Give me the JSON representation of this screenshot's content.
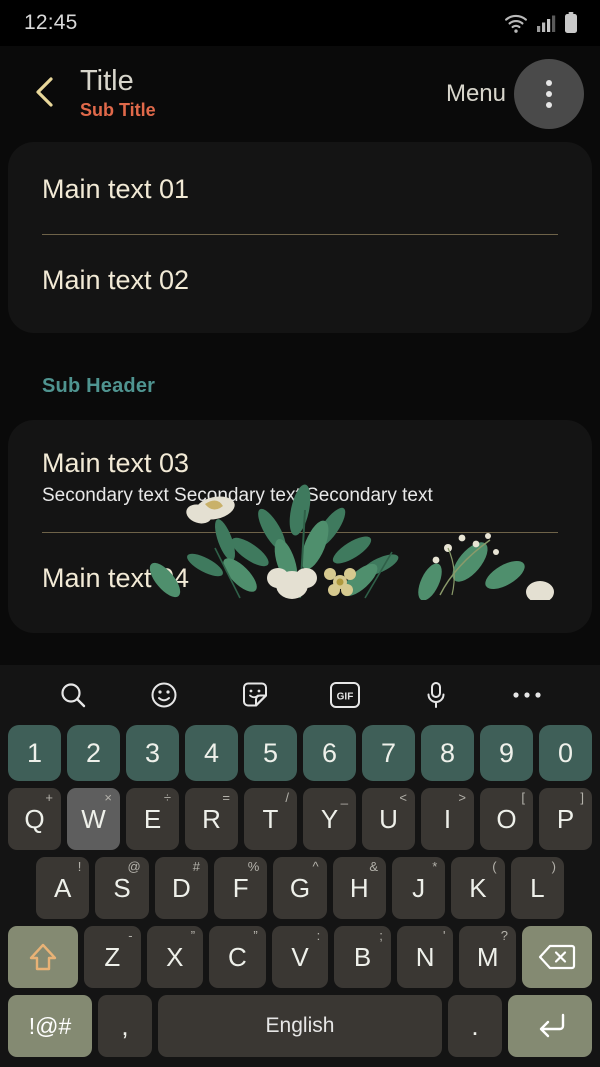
{
  "statusbar": {
    "time": "12:45",
    "icons": [
      "wifi-icon",
      "signal-icon",
      "battery-icon"
    ]
  },
  "appbar": {
    "back_icon": "chevron-left-icon",
    "title": "Title",
    "subtitle": "Sub Title",
    "menu_label": "Menu",
    "overflow_icon": "more-vertical-icon"
  },
  "content": {
    "card1": {
      "rows": [
        {
          "main": "Main text 01"
        },
        {
          "main": "Main text 02"
        }
      ]
    },
    "subheader": "Sub Header",
    "card2": {
      "rows": [
        {
          "main": "Main text 03",
          "secondary": "Secondary text Secondary text Secondary text"
        },
        {
          "main": "Main text 04"
        }
      ]
    },
    "decoration": "floral-illustration"
  },
  "keyboard": {
    "toolbar": [
      {
        "name": "search-icon",
        "label": "search"
      },
      {
        "name": "emoji-icon",
        "label": "emoji"
      },
      {
        "name": "sticker-icon",
        "label": "sticker"
      },
      {
        "name": "gif-icon",
        "label": "GIF"
      },
      {
        "name": "microphone-icon",
        "label": "voice input"
      },
      {
        "name": "more-horizontal-icon",
        "label": "more"
      }
    ],
    "number_row": [
      "1",
      "2",
      "3",
      "4",
      "5",
      "6",
      "7",
      "8",
      "9",
      "0"
    ],
    "row_qwerty": [
      {
        "key": "Q",
        "sup": "+"
      },
      {
        "key": "W",
        "sup": "×",
        "pressed": true
      },
      {
        "key": "E",
        "sup": "÷"
      },
      {
        "key": "R",
        "sup": "="
      },
      {
        "key": "T",
        "sup": "/"
      },
      {
        "key": "Y",
        "sup": "_"
      },
      {
        "key": "U",
        "sup": "<"
      },
      {
        "key": "I",
        "sup": ">"
      },
      {
        "key": "O",
        "sup": "["
      },
      {
        "key": "P",
        "sup": "]"
      }
    ],
    "row_asdf": [
      {
        "key": "A",
        "sup": "!"
      },
      {
        "key": "S",
        "sup": "@"
      },
      {
        "key": "D",
        "sup": "#"
      },
      {
        "key": "F",
        "sup": "%"
      },
      {
        "key": "G",
        "sup": "^"
      },
      {
        "key": "H",
        "sup": "&"
      },
      {
        "key": "J",
        "sup": "*"
      },
      {
        "key": "K",
        "sup": "("
      },
      {
        "key": "L",
        "sup": ")"
      }
    ],
    "row_zxcv": [
      {
        "key": "Z",
        "sup": "-"
      },
      {
        "key": "X",
        "sup": "”"
      },
      {
        "key": "C",
        "sup": "”"
      },
      {
        "key": "V",
        "sup": ":"
      },
      {
        "key": "B",
        "sup": ";"
      },
      {
        "key": "N",
        "sup": "'"
      },
      {
        "key": "M",
        "sup": "?"
      }
    ],
    "shift_icon": "shift-arrow-icon",
    "backspace_icon": "backspace-icon",
    "symbols_key": "!@#",
    "comma_key": ",",
    "space_key": "English",
    "period_key": ".",
    "enter_icon": "enter-arrow-icon"
  },
  "colors": {
    "page_bg": "#0a0a0a",
    "card_bg": "#141414",
    "title": "#d8d6cc",
    "subtitle_accent": "#e0694a",
    "main_text": "#f2ead6",
    "subheader_accent": "#4f9490",
    "divider": "#6e6349",
    "key_bg": "#3a3733",
    "key_num_bg": "#3f5f58",
    "key_fn_bg": "#848a72",
    "shift_arrow": "#e8b276"
  }
}
